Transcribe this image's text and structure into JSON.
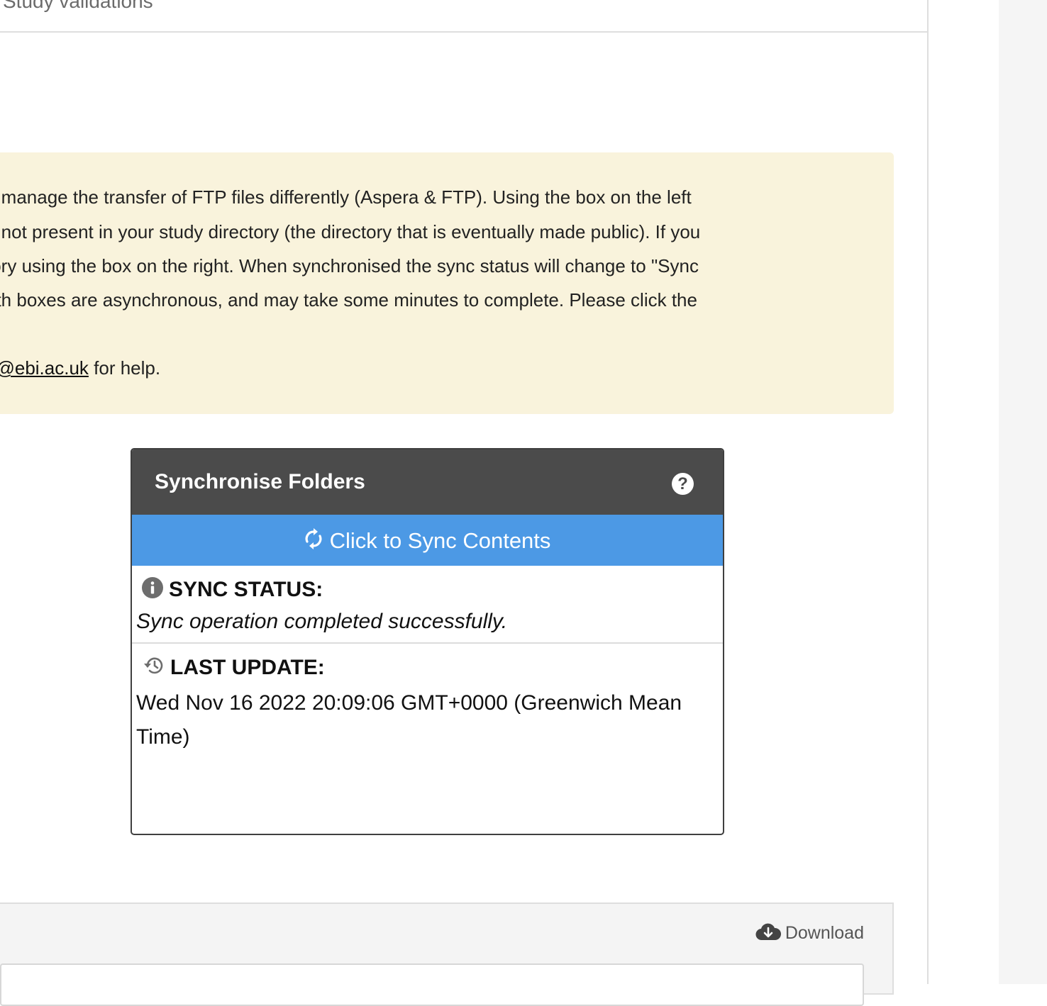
{
  "tabs": {
    "active_label": "Study validations"
  },
  "notice": {
    "lines": [
      "o manage the transfer of FTP files differently (Aspera & FTP). Using the box on the left",
      "e not present in your study directory (the directory that is eventually made public). If you",
      "tory using the box on the right. When synchronised the sync status will change to \"Sync",
      "oth boxes are asynchronous, and may take some minutes to complete. Please click the"
    ],
    "email_link": "p@ebi.ac.uk",
    "email_suffix": " for help."
  },
  "sync_panel": {
    "title": "Synchronise Folders",
    "help_icon": "question-circle-icon",
    "sync_button_label": "Click to Sync Contents",
    "sync_button_icon": "refresh-icon",
    "status_heading": "SYNC STATUS:",
    "status_icon": "info-icon",
    "status_text": "Sync operation completed successfully.",
    "update_heading": "LAST UPDATE:",
    "update_icon": "history-icon",
    "update_text": "Wed Nov 16 2022 20:09:06 GMT+0000 (Greenwich Mean Time)"
  },
  "files_panel": {
    "download_label": "Download",
    "download_icon": "cloud-download-icon"
  },
  "colors": {
    "notice_bg": "#f9f3dc",
    "header_bg": "#4b4b4b",
    "sync_button_bg": "#4c99e5"
  }
}
